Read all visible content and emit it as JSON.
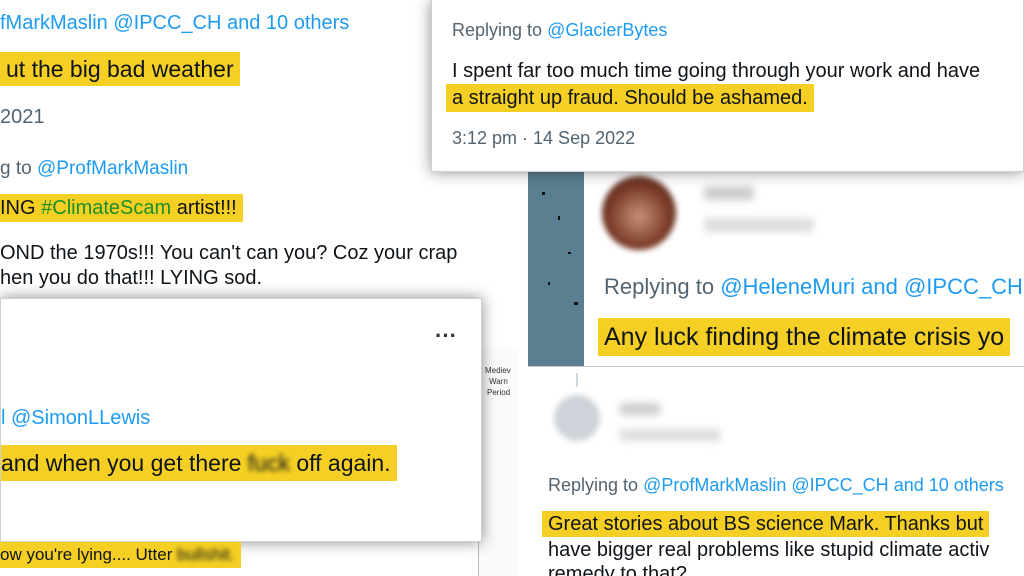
{
  "card1": {
    "mentions": "fMarkMaslin @IPCC_CH",
    "and_others": "and 10 others",
    "text": "ut the big bad weather",
    "date": "2021"
  },
  "card2": {
    "replying_prefix": "g to",
    "replying_handle": "@ProfMarkMaslin",
    "line1_a": "ING ",
    "line1_hashtag": "#ClimateScam",
    "line1_b": " artist!!!",
    "line2": "OND the 1970s!!! You can't can you? Coz your crap",
    "line3": "hen you do that!!! LYING sod."
  },
  "card3": {
    "replying_prefix": "Replying to",
    "replying_handle": "@GlacierBytes",
    "line1": "I spent far too much time going through your work and have",
    "line2": "a straight up fraud. Should be ashamed.",
    "timestamp": "3:12 pm · 14 Sep 2022"
  },
  "card4": {
    "more": "···",
    "replying_handle": "l @SimonLLewis",
    "text_a": "and when you get there",
    "text_blurred": "fuck",
    "text_b": "off again.",
    "footer_a": "ow you're lying.... Utter",
    "footer_blurred": "bullshit.",
    "chart_label_1": "Mediev",
    "chart_label_2": "Warn",
    "chart_label_3": "Period"
  },
  "card5": {
    "replying_prefix": "Replying to",
    "replying_handles": "@HeleneMuri and @IPCC_CH",
    "text": "Any luck finding the climate crisis yo"
  },
  "card6": {
    "replying_prefix": "Replying to",
    "mentions": "@ProfMarkMaslin @IPCC_CH",
    "and_others": "and 10 others",
    "line1": "Great stories about BS science Mark. Thanks but",
    "line2": "have bigger real problems like stupid climate activ",
    "line3": "remedy to that?"
  },
  "colors": {
    "highlight": "#f5cf23",
    "link": "#1d9bf0",
    "muted": "#536471",
    "text": "#0f1419",
    "hashtag": "#1a8f2a"
  }
}
